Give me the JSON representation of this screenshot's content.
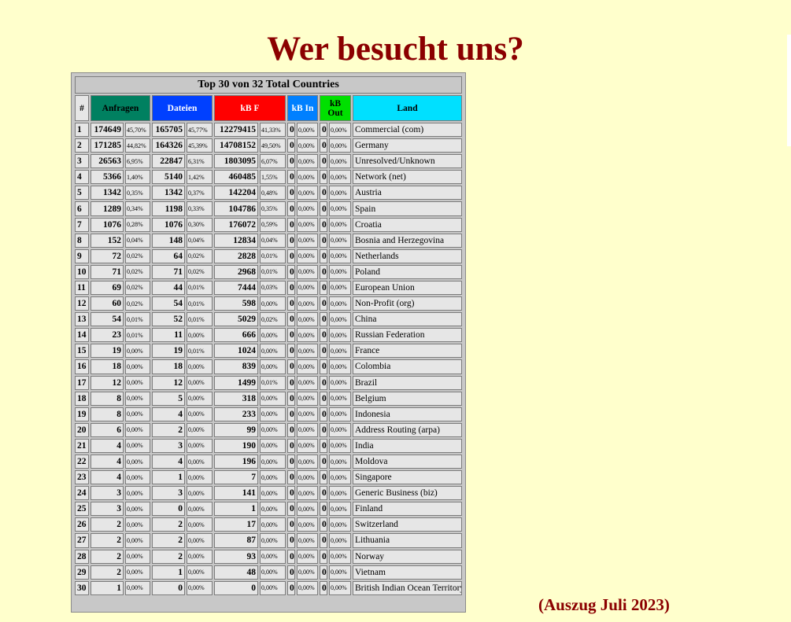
{
  "page": {
    "title": "Wer besucht uns?",
    "footnote": "(Auszug Juli 2023)"
  },
  "table": {
    "caption": "Top 30 von 32 Total Countries",
    "headers": {
      "rank": "#",
      "requests": "Anfragen",
      "files": "Dateien",
      "kbf": "kB F",
      "kbin": "kB In",
      "kbout": "kB Out",
      "country": "Land"
    },
    "header_colors": {
      "requests": "#008060",
      "files": "#0040ff",
      "kbf": "#ff0000",
      "kbin": "#0080ff",
      "kbout": "#00e000",
      "country": "#00e0ff"
    },
    "rows": [
      {
        "rank": "1",
        "req": "174649",
        "req_pct": "45,70%",
        "files": "165705",
        "files_pct": "45,77%",
        "kbf": "12279415",
        "kbf_pct": "41,33%",
        "kbin": "0",
        "kbin_pct": "0,00%",
        "kbout": "0",
        "kbout_pct": "0,00%",
        "country": "Commercial (com)"
      },
      {
        "rank": "2",
        "req": "171285",
        "req_pct": "44,82%",
        "files": "164326",
        "files_pct": "45,39%",
        "kbf": "14708152",
        "kbf_pct": "49,50%",
        "kbin": "0",
        "kbin_pct": "0,00%",
        "kbout": "0",
        "kbout_pct": "0,00%",
        "country": "Germany"
      },
      {
        "rank": "3",
        "req": "26563",
        "req_pct": "6,95%",
        "files": "22847",
        "files_pct": "6,31%",
        "kbf": "1803095",
        "kbf_pct": "6,07%",
        "kbin": "0",
        "kbin_pct": "0,00%",
        "kbout": "0",
        "kbout_pct": "0,00%",
        "country": "Unresolved/Unknown"
      },
      {
        "rank": "4",
        "req": "5366",
        "req_pct": "1,40%",
        "files": "5140",
        "files_pct": "1,42%",
        "kbf": "460485",
        "kbf_pct": "1,55%",
        "kbin": "0",
        "kbin_pct": "0,00%",
        "kbout": "0",
        "kbout_pct": "0,00%",
        "country": "Network (net)"
      },
      {
        "rank": "5",
        "req": "1342",
        "req_pct": "0,35%",
        "files": "1342",
        "files_pct": "0,37%",
        "kbf": "142204",
        "kbf_pct": "0,48%",
        "kbin": "0",
        "kbin_pct": "0,00%",
        "kbout": "0",
        "kbout_pct": "0,00%",
        "country": "Austria"
      },
      {
        "rank": "6",
        "req": "1289",
        "req_pct": "0,34%",
        "files": "1198",
        "files_pct": "0,33%",
        "kbf": "104786",
        "kbf_pct": "0,35%",
        "kbin": "0",
        "kbin_pct": "0,00%",
        "kbout": "0",
        "kbout_pct": "0,00%",
        "country": "Spain"
      },
      {
        "rank": "7",
        "req": "1076",
        "req_pct": "0,28%",
        "files": "1076",
        "files_pct": "0,30%",
        "kbf": "176072",
        "kbf_pct": "0,59%",
        "kbin": "0",
        "kbin_pct": "0,00%",
        "kbout": "0",
        "kbout_pct": "0,00%",
        "country": "Croatia"
      },
      {
        "rank": "8",
        "req": "152",
        "req_pct": "0,04%",
        "files": "148",
        "files_pct": "0,04%",
        "kbf": "12834",
        "kbf_pct": "0,04%",
        "kbin": "0",
        "kbin_pct": "0,00%",
        "kbout": "0",
        "kbout_pct": "0,00%",
        "country": "Bosnia and Herzegovina"
      },
      {
        "rank": "9",
        "req": "72",
        "req_pct": "0,02%",
        "files": "64",
        "files_pct": "0,02%",
        "kbf": "2828",
        "kbf_pct": "0,01%",
        "kbin": "0",
        "kbin_pct": "0,00%",
        "kbout": "0",
        "kbout_pct": "0,00%",
        "country": "Netherlands"
      },
      {
        "rank": "10",
        "req": "71",
        "req_pct": "0,02%",
        "files": "71",
        "files_pct": "0,02%",
        "kbf": "2968",
        "kbf_pct": "0,01%",
        "kbin": "0",
        "kbin_pct": "0,00%",
        "kbout": "0",
        "kbout_pct": "0,00%",
        "country": "Poland"
      },
      {
        "rank": "11",
        "req": "69",
        "req_pct": "0,02%",
        "files": "44",
        "files_pct": "0,01%",
        "kbf": "7444",
        "kbf_pct": "0,03%",
        "kbin": "0",
        "kbin_pct": "0,00%",
        "kbout": "0",
        "kbout_pct": "0,00%",
        "country": "European Union"
      },
      {
        "rank": "12",
        "req": "60",
        "req_pct": "0,02%",
        "files": "54",
        "files_pct": "0,01%",
        "kbf": "598",
        "kbf_pct": "0,00%",
        "kbin": "0",
        "kbin_pct": "0,00%",
        "kbout": "0",
        "kbout_pct": "0,00%",
        "country": "Non-Profit (org)"
      },
      {
        "rank": "13",
        "req": "54",
        "req_pct": "0,01%",
        "files": "52",
        "files_pct": "0,01%",
        "kbf": "5029",
        "kbf_pct": "0,02%",
        "kbin": "0",
        "kbin_pct": "0,00%",
        "kbout": "0",
        "kbout_pct": "0,00%",
        "country": "China"
      },
      {
        "rank": "14",
        "req": "23",
        "req_pct": "0,01%",
        "files": "11",
        "files_pct": "0,00%",
        "kbf": "666",
        "kbf_pct": "0,00%",
        "kbin": "0",
        "kbin_pct": "0,00%",
        "kbout": "0",
        "kbout_pct": "0,00%",
        "country": "Russian Federation"
      },
      {
        "rank": "15",
        "req": "19",
        "req_pct": "0,00%",
        "files": "19",
        "files_pct": "0,01%",
        "kbf": "1024",
        "kbf_pct": "0,00%",
        "kbin": "0",
        "kbin_pct": "0,00%",
        "kbout": "0",
        "kbout_pct": "0,00%",
        "country": "France"
      },
      {
        "rank": "16",
        "req": "18",
        "req_pct": "0,00%",
        "files": "18",
        "files_pct": "0,00%",
        "kbf": "839",
        "kbf_pct": "0,00%",
        "kbin": "0",
        "kbin_pct": "0,00%",
        "kbout": "0",
        "kbout_pct": "0,00%",
        "country": "Colombia"
      },
      {
        "rank": "17",
        "req": "12",
        "req_pct": "0,00%",
        "files": "12",
        "files_pct": "0,00%",
        "kbf": "1499",
        "kbf_pct": "0,01%",
        "kbin": "0",
        "kbin_pct": "0,00%",
        "kbout": "0",
        "kbout_pct": "0,00%",
        "country": "Brazil"
      },
      {
        "rank": "18",
        "req": "8",
        "req_pct": "0,00%",
        "files": "5",
        "files_pct": "0,00%",
        "kbf": "318",
        "kbf_pct": "0,00%",
        "kbin": "0",
        "kbin_pct": "0,00%",
        "kbout": "0",
        "kbout_pct": "0,00%",
        "country": "Belgium"
      },
      {
        "rank": "19",
        "req": "8",
        "req_pct": "0,00%",
        "files": "4",
        "files_pct": "0,00%",
        "kbf": "233",
        "kbf_pct": "0,00%",
        "kbin": "0",
        "kbin_pct": "0,00%",
        "kbout": "0",
        "kbout_pct": "0,00%",
        "country": "Indonesia"
      },
      {
        "rank": "20",
        "req": "6",
        "req_pct": "0,00%",
        "files": "2",
        "files_pct": "0,00%",
        "kbf": "99",
        "kbf_pct": "0,00%",
        "kbin": "0",
        "kbin_pct": "0,00%",
        "kbout": "0",
        "kbout_pct": "0,00%",
        "country": "Address Routing (arpa)"
      },
      {
        "rank": "21",
        "req": "4",
        "req_pct": "0,00%",
        "files": "3",
        "files_pct": "0,00%",
        "kbf": "190",
        "kbf_pct": "0,00%",
        "kbin": "0",
        "kbin_pct": "0,00%",
        "kbout": "0",
        "kbout_pct": "0,00%",
        "country": "India"
      },
      {
        "rank": "22",
        "req": "4",
        "req_pct": "0,00%",
        "files": "4",
        "files_pct": "0,00%",
        "kbf": "196",
        "kbf_pct": "0,00%",
        "kbin": "0",
        "kbin_pct": "0,00%",
        "kbout": "0",
        "kbout_pct": "0,00%",
        "country": "Moldova"
      },
      {
        "rank": "23",
        "req": "4",
        "req_pct": "0,00%",
        "files": "1",
        "files_pct": "0,00%",
        "kbf": "7",
        "kbf_pct": "0,00%",
        "kbin": "0",
        "kbin_pct": "0,00%",
        "kbout": "0",
        "kbout_pct": "0,00%",
        "country": "Singapore"
      },
      {
        "rank": "24",
        "req": "3",
        "req_pct": "0,00%",
        "files": "3",
        "files_pct": "0,00%",
        "kbf": "141",
        "kbf_pct": "0,00%",
        "kbin": "0",
        "kbin_pct": "0,00%",
        "kbout": "0",
        "kbout_pct": "0,00%",
        "country": "Generic Business (biz)"
      },
      {
        "rank": "25",
        "req": "3",
        "req_pct": "0,00%",
        "files": "0",
        "files_pct": "0,00%",
        "kbf": "1",
        "kbf_pct": "0,00%",
        "kbin": "0",
        "kbin_pct": "0,00%",
        "kbout": "0",
        "kbout_pct": "0,00%",
        "country": "Finland"
      },
      {
        "rank": "26",
        "req": "2",
        "req_pct": "0,00%",
        "files": "2",
        "files_pct": "0,00%",
        "kbf": "17",
        "kbf_pct": "0,00%",
        "kbin": "0",
        "kbin_pct": "0,00%",
        "kbout": "0",
        "kbout_pct": "0,00%",
        "country": "Switzerland"
      },
      {
        "rank": "27",
        "req": "2",
        "req_pct": "0,00%",
        "files": "2",
        "files_pct": "0,00%",
        "kbf": "87",
        "kbf_pct": "0,00%",
        "kbin": "0",
        "kbin_pct": "0,00%",
        "kbout": "0",
        "kbout_pct": "0,00%",
        "country": "Lithuania"
      },
      {
        "rank": "28",
        "req": "2",
        "req_pct": "0,00%",
        "files": "2",
        "files_pct": "0,00%",
        "kbf": "93",
        "kbf_pct": "0,00%",
        "kbin": "0",
        "kbin_pct": "0,00%",
        "kbout": "0",
        "kbout_pct": "0,00%",
        "country": "Norway"
      },
      {
        "rank": "29",
        "req": "2",
        "req_pct": "0,00%",
        "files": "1",
        "files_pct": "0,00%",
        "kbf": "48",
        "kbf_pct": "0,00%",
        "kbin": "0",
        "kbin_pct": "0,00%",
        "kbout": "0",
        "kbout_pct": "0,00%",
        "country": "Vietnam"
      },
      {
        "rank": "30",
        "req": "1",
        "req_pct": "0,00%",
        "files": "0",
        "files_pct": "0,00%",
        "kbf": "0",
        "kbf_pct": "0,00%",
        "kbin": "0",
        "kbin_pct": "0,00%",
        "kbout": "0",
        "kbout_pct": "0,00%",
        "country": "British Indian Ocean Territory"
      }
    ]
  }
}
